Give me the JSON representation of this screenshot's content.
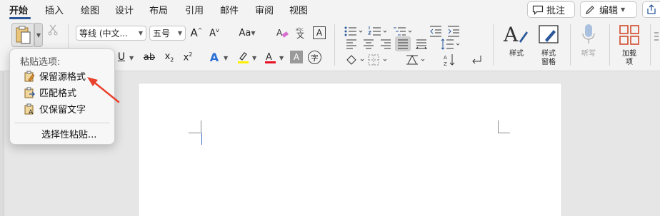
{
  "tabs": [
    "开始",
    "插入",
    "绘图",
    "设计",
    "布局",
    "引用",
    "邮件",
    "审阅",
    "视图"
  ],
  "active_tab": "开始",
  "comment_button": "批注",
  "edit_button": "编辑",
  "font": {
    "name": "等线 (中文...",
    "size": "五号"
  },
  "ribbon": {
    "styles_label": "样式",
    "styles_pane_label": "样式\n窗格",
    "dictate_label": "听写",
    "addins_label": "加载\n项"
  },
  "paste_menu": {
    "title": "粘贴选项:",
    "items": [
      "保留源格式",
      "匹配格式",
      "仅保留文字"
    ],
    "special": "选择性粘贴..."
  },
  "colors": {
    "accent": "#2b579a",
    "highlight_yellow": "#ffef00",
    "font_red": "#e81123",
    "annotation_arrow": "#e8412c"
  }
}
